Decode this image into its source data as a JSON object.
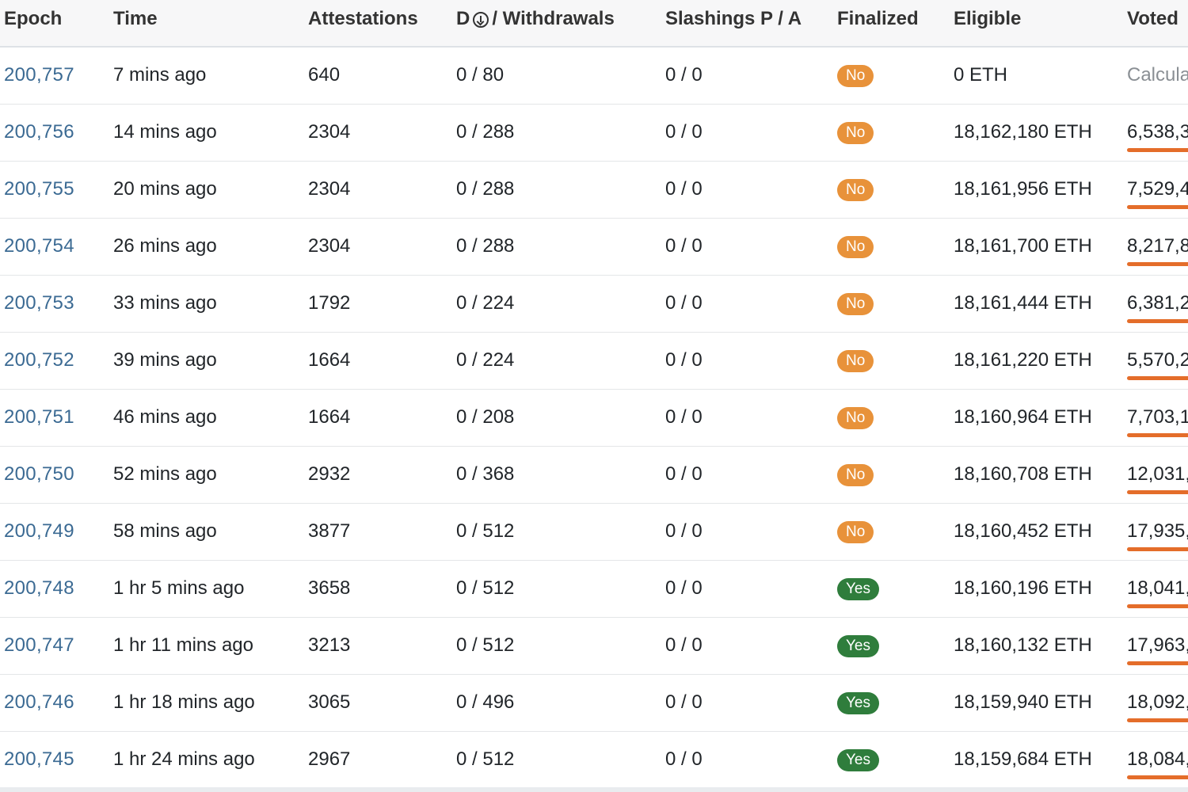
{
  "columns": {
    "epoch": "Epoch",
    "time": "Time",
    "attestations": "Attestations",
    "deposits_prefix": "D",
    "deposits_icon": "download-circle-icon",
    "withdrawals_suffix": "/ Withdrawals",
    "slashings": "Slashings P / A",
    "finalized": "Finalized",
    "eligible": "Eligible",
    "voted": "Voted"
  },
  "colors": {
    "link": "#3b6a93",
    "badge_no": "#e8923a",
    "badge_yes": "#2f7d3c",
    "voted_bar": "#e46d2a"
  },
  "rows": [
    {
      "epoch": "200,757",
      "time": "7 mins ago",
      "attestations": "640",
      "dw": "0 / 80",
      "slashings": "0 / 0",
      "finalized": "No",
      "eligible": "0 ETH",
      "voted": "Calcula"
    },
    {
      "epoch": "200,756",
      "time": "14 mins ago",
      "attestations": "2304",
      "dw": "0 / 288",
      "slashings": "0 / 0",
      "finalized": "No",
      "eligible": "18,162,180 ETH",
      "voted": "6,538,3"
    },
    {
      "epoch": "200,755",
      "time": "20 mins ago",
      "attestations": "2304",
      "dw": "0 / 288",
      "slashings": "0 / 0",
      "finalized": "No",
      "eligible": "18,161,956 ETH",
      "voted": "7,529,4"
    },
    {
      "epoch": "200,754",
      "time": "26 mins ago",
      "attestations": "2304",
      "dw": "0 / 288",
      "slashings": "0 / 0",
      "finalized": "No",
      "eligible": "18,161,700 ETH",
      "voted": "8,217,8"
    },
    {
      "epoch": "200,753",
      "time": "33 mins ago",
      "attestations": "1792",
      "dw": "0 / 224",
      "slashings": "0 / 0",
      "finalized": "No",
      "eligible": "18,161,444 ETH",
      "voted": "6,381,2"
    },
    {
      "epoch": "200,752",
      "time": "39 mins ago",
      "attestations": "1664",
      "dw": "0 / 224",
      "slashings": "0 / 0",
      "finalized": "No",
      "eligible": "18,161,220 ETH",
      "voted": "5,570,2"
    },
    {
      "epoch": "200,751",
      "time": "46 mins ago",
      "attestations": "1664",
      "dw": "0 / 208",
      "slashings": "0 / 0",
      "finalized": "No",
      "eligible": "18,160,964 ETH",
      "voted": "7,703,1"
    },
    {
      "epoch": "200,750",
      "time": "52 mins ago",
      "attestations": "2932",
      "dw": "0 / 368",
      "slashings": "0 / 0",
      "finalized": "No",
      "eligible": "18,160,708 ETH",
      "voted": "12,031,"
    },
    {
      "epoch": "200,749",
      "time": "58 mins ago",
      "attestations": "3877",
      "dw": "0 / 512",
      "slashings": "0 / 0",
      "finalized": "No",
      "eligible": "18,160,452 ETH",
      "voted": "17,935,"
    },
    {
      "epoch": "200,748",
      "time": "1 hr 5 mins ago",
      "attestations": "3658",
      "dw": "0 / 512",
      "slashings": "0 / 0",
      "finalized": "Yes",
      "eligible": "18,160,196 ETH",
      "voted": "18,041,"
    },
    {
      "epoch": "200,747",
      "time": "1 hr 11 mins ago",
      "attestations": "3213",
      "dw": "0 / 512",
      "slashings": "0 / 0",
      "finalized": "Yes",
      "eligible": "18,160,132 ETH",
      "voted": "17,963,"
    },
    {
      "epoch": "200,746",
      "time": "1 hr 18 mins ago",
      "attestations": "3065",
      "dw": "0 / 496",
      "slashings": "0 / 0",
      "finalized": "Yes",
      "eligible": "18,159,940 ETH",
      "voted": "18,092,"
    },
    {
      "epoch": "200,745",
      "time": "1 hr 24 mins ago",
      "attestations": "2967",
      "dw": "0 / 512",
      "slashings": "0 / 0",
      "finalized": "Yes",
      "eligible": "18,159,684 ETH",
      "voted": "18,084,"
    }
  ]
}
